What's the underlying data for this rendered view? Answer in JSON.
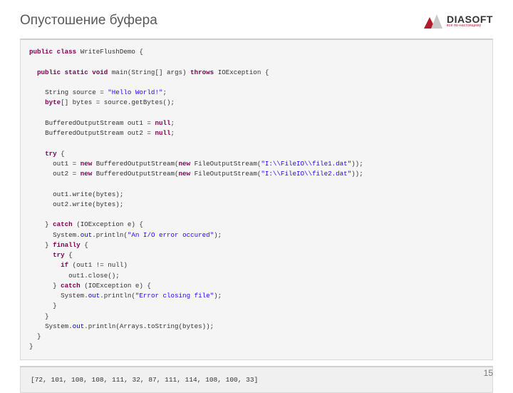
{
  "title": "Опустошение буфера",
  "logo": {
    "text": "DIASOFT",
    "tagline": "всё по-настоящему",
    "brand_color": "#b01c2e"
  },
  "code": {
    "class_decl": "public class",
    "class_name": "WriteFlushDemo",
    "main_sig_pre": "public static void",
    "main_name": "main(String[] args)",
    "throws_kw": "throws",
    "throws_type": "IOException",
    "src_decl": "String source =",
    "src_val": "\"Hello World!\"",
    "bytes_decl": "byte",
    "bytes_rest": "[] bytes = source.getBytes();",
    "bos_type": "BufferedOutputStream",
    "out1": "out1",
    "out2": "out2",
    "null_kw": "null",
    "try_kw": "try",
    "new_kw": "new",
    "fos_type": "FileOutputStream",
    "path1": "\"I:\\\\FileIO\\\\file1.dat\"",
    "path2": "\"I:\\\\FileIO\\\\file2.dat\"",
    "write1": "out1.write(bytes);",
    "write2": "out2.write(bytes);",
    "catch_kw": "catch",
    "catch_sig": "(IOException e)",
    "sysout_pre": "System.",
    "out_field": "out",
    "println": ".println(",
    "err1": "\"An I/O error occured\"",
    "finally_kw": "finally",
    "if_kw": "if",
    "if_cond": "(out1 != null)",
    "close": "out1.close();",
    "err2": "\"Error closing file\"",
    "tostring": "Arrays.toString(bytes));"
  },
  "output": "[72, 101, 108, 108, 111, 32, 87, 111, 114, 108, 100, 33]",
  "page_number": "15"
}
